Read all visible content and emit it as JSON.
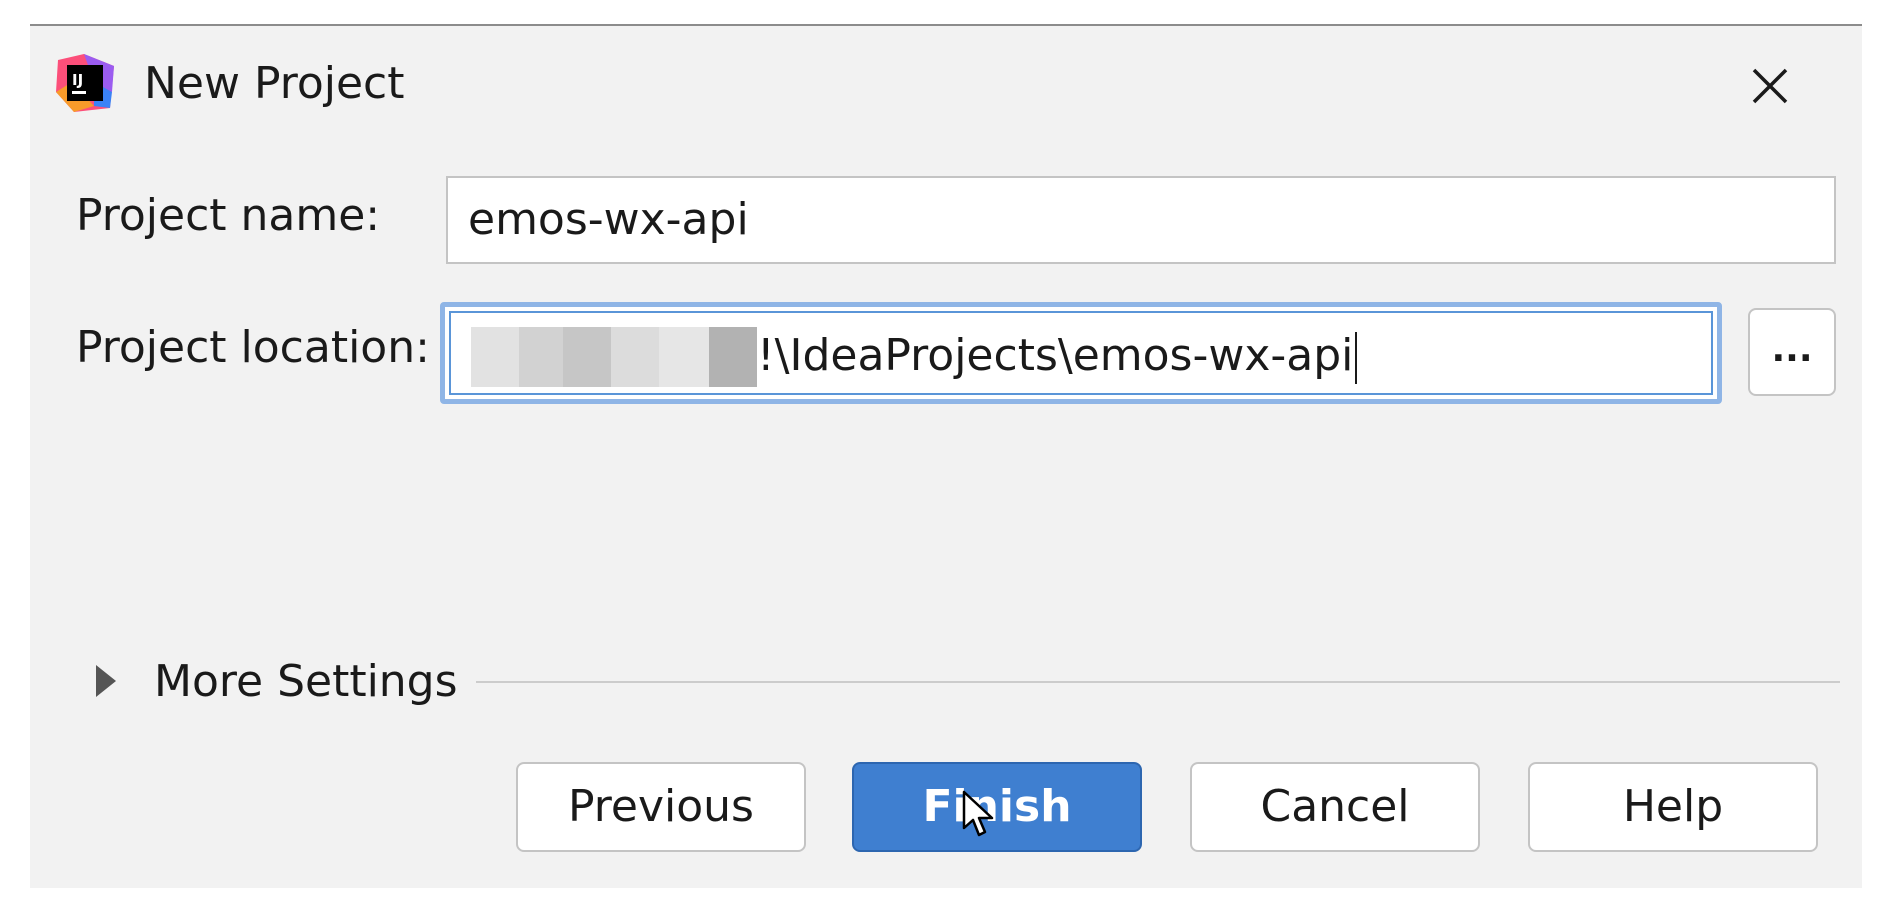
{
  "dialog": {
    "title": "New Project",
    "app_icon": "intellij-idea-icon",
    "close_icon": "close-icon"
  },
  "form": {
    "project_name_label": "Project name:",
    "project_name_value": "emos-wx-api",
    "project_location_label": "Project location:",
    "project_location_visible_value": "!\\IdeaProjects\\emos-wx-api",
    "browse_label": "..."
  },
  "more_settings": {
    "label": "More Settings",
    "expand_icon": "triangle-right-icon"
  },
  "buttons": {
    "previous": "Previous",
    "finish": "Finish",
    "cancel": "Cancel",
    "help": "Help"
  },
  "colors": {
    "dialog_background": "#f2f2f2",
    "primary_button": "#3f7fd0",
    "focus_border": "#8fb5e6"
  }
}
